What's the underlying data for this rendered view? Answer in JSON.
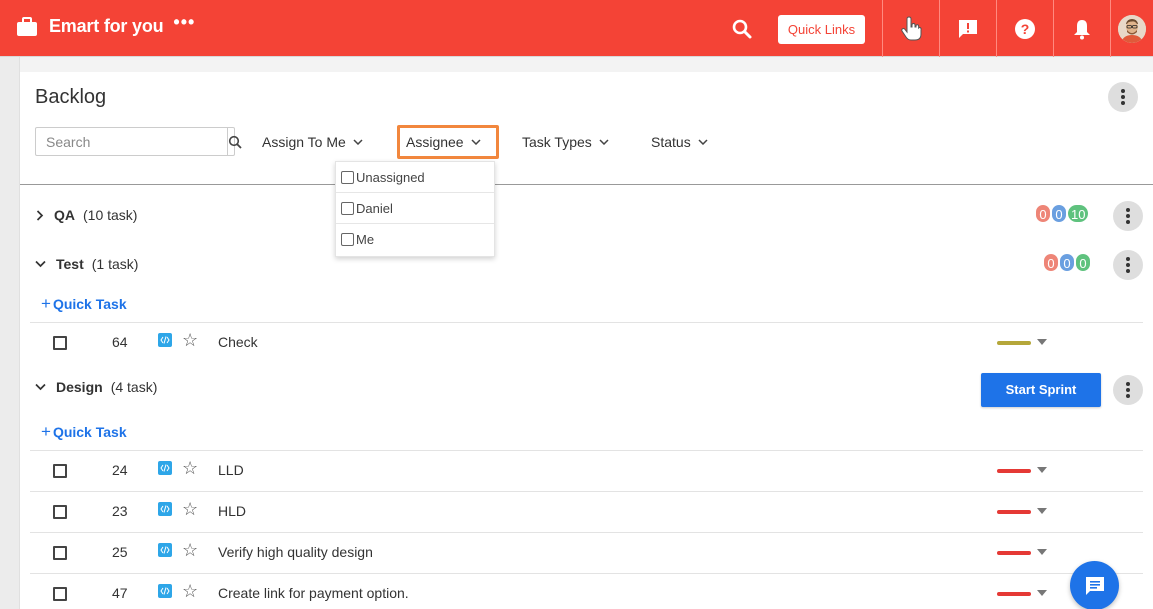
{
  "header": {
    "app_title": "Emart for you",
    "more_label": "•••",
    "quick_links_label": "Quick Links",
    "icons": [
      "search-icon",
      "hand-pointer-icon",
      "feedback-icon",
      "help-icon",
      "bell-icon",
      "avatar"
    ],
    "bg_color": "#f44336"
  },
  "page": {
    "title": "Backlog"
  },
  "filters": {
    "search_placeholder": "Search",
    "search_value": "",
    "assign_to_me": "Assign To Me",
    "assignee": "Assignee",
    "task_types": "Task Types",
    "status": "Status"
  },
  "assignee_dropdown": {
    "options": [
      {
        "label": "Unassigned",
        "checked": false
      },
      {
        "label": "Daniel",
        "checked": false
      },
      {
        "label": "Me",
        "checked": false
      }
    ]
  },
  "groups": [
    {
      "name": "QA",
      "count_label": "(10 task)",
      "expanded": false,
      "badges": [
        "0",
        "0",
        "10"
      ]
    },
    {
      "name": "Test",
      "count_label": "(1 task)",
      "expanded": true,
      "badges": [
        "0",
        "0",
        "0"
      ],
      "quick_task_label": "Quick Task",
      "tasks": [
        {
          "id": "64",
          "title": "Check",
          "priority_color": "#b5a73a"
        }
      ]
    },
    {
      "name": "Design",
      "count_label": "(4 task)",
      "expanded": true,
      "start_sprint_label": "Start Sprint",
      "quick_task_label": "Quick Task",
      "tasks": [
        {
          "id": "24",
          "title": "LLD",
          "priority_color": "#e53935"
        },
        {
          "id": "23",
          "title": "HLD",
          "priority_color": "#e53935"
        },
        {
          "id": "25",
          "title": "Verify high quality design",
          "priority_color": "#e53935"
        },
        {
          "id": "47",
          "title": "Create link for payment option.",
          "priority_color": "#e53935"
        }
      ]
    }
  ],
  "colors": {
    "accent": "#1e73e8",
    "badge_red": "#ee8577",
    "badge_blue": "#6a9fe0",
    "badge_green": "#5fc27e",
    "filter_highlight": "#f2873d"
  }
}
